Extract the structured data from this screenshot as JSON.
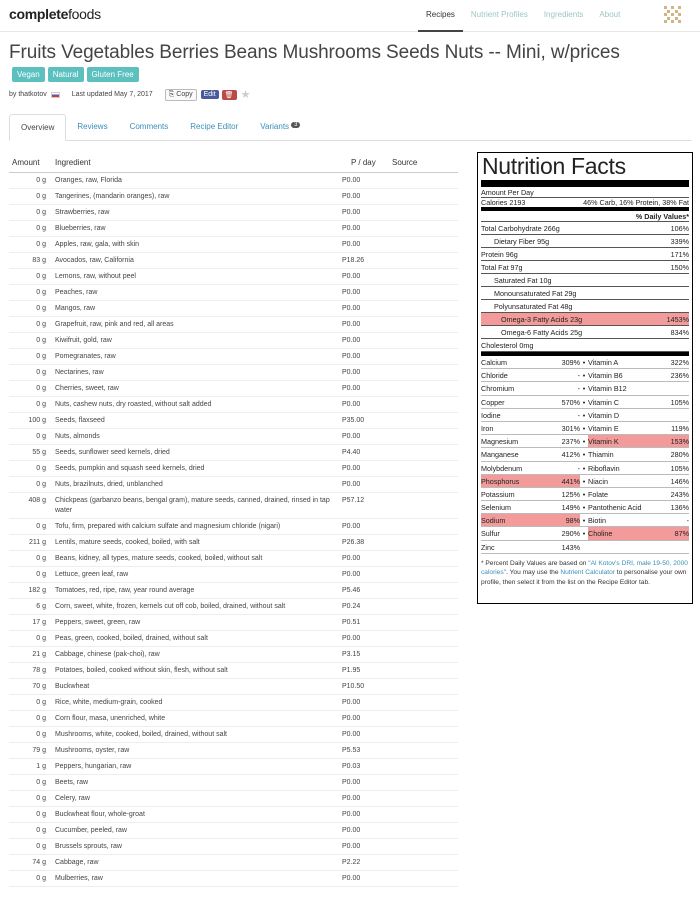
{
  "header": {
    "logo_bold": "complete",
    "logo_light": "foods",
    "nav": [
      "Recipes",
      "Nutrient Profiles",
      "Ingredients",
      "About"
    ]
  },
  "recipe": {
    "title": "Fruits Vegetables Berries Beans Mushrooms Seeds Nuts -- Mini, w/prices",
    "tags": [
      "Vegan",
      "Natural",
      "Gluten Free"
    ],
    "by": "by thatkotov",
    "updated": "Last updated May 7, 2017",
    "copy_label": "Copy",
    "edit_label": "Edit"
  },
  "tabs": [
    {
      "label": "Overview"
    },
    {
      "label": "Reviews"
    },
    {
      "label": "Comments"
    },
    {
      "label": "Recipe Editor"
    },
    {
      "label": "Variants",
      "badge": "3"
    }
  ],
  "table": {
    "headers": {
      "amount": "Amount",
      "ingredient": "Ingredient",
      "price": "P / day",
      "source": "Source"
    },
    "rows": [
      {
        "amount": "0 g",
        "name": "Oranges, raw, Florida",
        "price": "P0.00"
      },
      {
        "amount": "0 g",
        "name": "Tangerines, (mandarin oranges), raw",
        "price": "P0.00"
      },
      {
        "amount": "0 g",
        "name": "Strawberries, raw",
        "price": "P0.00"
      },
      {
        "amount": "0 g",
        "name": "Blueberries, raw",
        "price": "P0.00"
      },
      {
        "amount": "0 g",
        "name": "Apples, raw, gala, with skin",
        "price": "P0.00"
      },
      {
        "amount": "83 g",
        "name": "Avocados, raw, California",
        "price": "P18.26"
      },
      {
        "amount": "0 g",
        "name": "Lemons, raw, without peel",
        "price": "P0.00"
      },
      {
        "amount": "0 g",
        "name": "Peaches, raw",
        "price": "P0.00"
      },
      {
        "amount": "0 g",
        "name": "Mangos, raw",
        "price": "P0.00"
      },
      {
        "amount": "0 g",
        "name": "Grapefruit, raw, pink and red, all areas",
        "price": "P0.00"
      },
      {
        "amount": "0 g",
        "name": "Kiwifruit, gold, raw",
        "price": "P0.00"
      },
      {
        "amount": "0 g",
        "name": "Pomegranates, raw",
        "price": "P0.00"
      },
      {
        "amount": "0 g",
        "name": "Nectarines, raw",
        "price": "P0.00"
      },
      {
        "amount": "0 g",
        "name": "Cherries, sweet, raw",
        "price": "P0.00"
      },
      {
        "amount": "0 g",
        "name": "Nuts, cashew nuts, dry roasted, without salt added",
        "price": "P0.00"
      },
      {
        "amount": "100 g",
        "name": "Seeds, flaxseed",
        "price": "P35.00"
      },
      {
        "amount": "0 g",
        "name": "Nuts, almonds",
        "price": "P0.00"
      },
      {
        "amount": "55 g",
        "name": "Seeds, sunflower seed kernels, dried",
        "price": "P4.40"
      },
      {
        "amount": "0 g",
        "name": "Seeds, pumpkin and squash seed kernels, dried",
        "price": "P0.00"
      },
      {
        "amount": "0 g",
        "name": "Nuts, brazilnuts, dried, unblanched",
        "price": "P0.00"
      },
      {
        "amount": "408 g",
        "name": "Chickpeas (garbanzo beans, bengal gram), mature seeds, canned, drained, rinsed in tap water",
        "price": "P57.12"
      },
      {
        "amount": "0 g",
        "name": "Tofu, firm, prepared with calcium sulfate and magnesium chloride (nigari)",
        "price": "P0.00"
      },
      {
        "amount": "211 g",
        "name": "Lentils, mature seeds, cooked, boiled, with salt",
        "price": "P26.38"
      },
      {
        "amount": "0 g",
        "name": "Beans, kidney, all types, mature seeds, cooked, boiled, without salt",
        "price": "P0.00"
      },
      {
        "amount": "0 g",
        "name": "Lettuce, green leaf, raw",
        "price": "P0.00"
      },
      {
        "amount": "182 g",
        "name": "Tomatoes, red, ripe, raw, year round average",
        "price": "P5.46"
      },
      {
        "amount": "6 g",
        "name": "Corn, sweet, white, frozen, kernels cut off cob, boiled, drained, without salt",
        "price": "P0.24"
      },
      {
        "amount": "17 g",
        "name": "Peppers, sweet, green, raw",
        "price": "P0.51"
      },
      {
        "amount": "0 g",
        "name": "Peas, green, cooked, boiled, drained, without salt",
        "price": "P0.00"
      },
      {
        "amount": "21 g",
        "name": "Cabbage, chinese (pak-choi), raw",
        "price": "P3.15"
      },
      {
        "amount": "78 g",
        "name": "Potatoes, boiled, cooked without skin, flesh, without salt",
        "price": "P1.95"
      },
      {
        "amount": "70 g",
        "name": "Buckwheat",
        "price": "P10.50"
      },
      {
        "amount": "0 g",
        "name": "Rice, white, medium-grain, cooked",
        "price": "P0.00"
      },
      {
        "amount": "0 g",
        "name": "Corn flour, masa, unenriched, white",
        "price": "P0.00"
      },
      {
        "amount": "0 g",
        "name": "Mushrooms, white, cooked, boiled, drained, without salt",
        "price": "P0.00"
      },
      {
        "amount": "79 g",
        "name": "Mushrooms, oyster, raw",
        "price": "P5.53"
      },
      {
        "amount": "1 g",
        "name": "Peppers, hungarian, raw",
        "price": "P0.03"
      },
      {
        "amount": "0 g",
        "name": "Beets, raw",
        "price": "P0.00"
      },
      {
        "amount": "0 g",
        "name": "Celery, raw",
        "price": "P0.00"
      },
      {
        "amount": "0 g",
        "name": "Buckwheat flour, whole-groat",
        "price": "P0.00"
      },
      {
        "amount": "0 g",
        "name": "Cucumber, peeled, raw",
        "price": "P0.00"
      },
      {
        "amount": "0 g",
        "name": "Brussels sprouts, raw",
        "price": "P0.00"
      },
      {
        "amount": "74 g",
        "name": "Cabbage, raw",
        "price": "P2.22"
      },
      {
        "amount": "0 g",
        "name": "Mulberries, raw",
        "price": "P0.00"
      }
    ]
  },
  "nutrition": {
    "title": "Nutrition Facts",
    "amount_per_day": "Amount Per Day",
    "calories_label": "Calories 2193",
    "calories_split": "46% Carb, 16% Protein, 38% Fat",
    "dv_header": "% Daily Values*",
    "macros": [
      {
        "label": "Total Carbohydrate 266g",
        "value": "106%",
        "indent": false,
        "highlight": false
      },
      {
        "label": "Dietary Fiber 95g",
        "value": "339%",
        "indent": true,
        "highlight": false
      },
      {
        "label": "Protein 96g",
        "value": "171%",
        "indent": false,
        "highlight": false
      },
      {
        "label": "Total Fat 97g",
        "value": "150%",
        "indent": false,
        "highlight": false
      },
      {
        "label": "Saturated Fat 10g",
        "value": "",
        "indent": true,
        "highlight": false
      },
      {
        "label": "Monounsaturated Fat 29g",
        "value": "",
        "indent": true,
        "highlight": false
      },
      {
        "label": "Polyunsaturated Fat 48g",
        "value": "",
        "indent": true,
        "highlight": false
      },
      {
        "label": "Omega-3 Fatty Acids 23g",
        "value": "1453%",
        "indent": true,
        "highlight": true
      },
      {
        "label": "Omega-6 Fatty Acids 25g",
        "value": "834%",
        "indent": true,
        "highlight": false
      },
      {
        "label": "Cholesterol 0mg",
        "value": "",
        "indent": false,
        "highlight": false
      }
    ],
    "micros": [
      {
        "l": "Calcium",
        "lv": "309%",
        "r": "Vitamin A",
        "rv": "322%",
        "lh": false,
        "rh": false
      },
      {
        "l": "Chloride",
        "lv": "-",
        "r": "Vitamin B6",
        "rv": "236%",
        "lh": false,
        "rh": false
      },
      {
        "l": "Chromium",
        "lv": "-",
        "r": "Vitamin B12",
        "rv": "",
        "lh": false,
        "rh": false
      },
      {
        "l": "Copper",
        "lv": "570%",
        "r": "Vitamin C",
        "rv": "105%",
        "lh": false,
        "rh": false
      },
      {
        "l": "Iodine",
        "lv": "-",
        "r": "Vitamin D",
        "rv": "",
        "lh": false,
        "rh": false
      },
      {
        "l": "Iron",
        "lv": "301%",
        "r": "Vitamin E",
        "rv": "119%",
        "lh": false,
        "rh": false
      },
      {
        "l": "Magnesium",
        "lv": "237%",
        "r": "Vitamin K",
        "rv": "153%",
        "lh": false,
        "rh": true
      },
      {
        "l": "Manganese",
        "lv": "412%",
        "r": "Thiamin",
        "rv": "280%",
        "lh": false,
        "rh": false
      },
      {
        "l": "Molybdenum",
        "lv": "-",
        "r": "Riboflavin",
        "rv": "105%",
        "lh": false,
        "rh": false
      },
      {
        "l": "Phosphorus",
        "lv": "441%",
        "r": "Niacin",
        "rv": "146%",
        "lh": true,
        "rh": false
      },
      {
        "l": "Potassium",
        "lv": "125%",
        "r": "Folate",
        "rv": "243%",
        "lh": false,
        "rh": false
      },
      {
        "l": "Selenium",
        "lv": "149%",
        "r": "Pantothenic Acid",
        "rv": "136%",
        "lh": false,
        "rh": false
      },
      {
        "l": "Sodium",
        "lv": "98%",
        "r": "Biotin",
        "rv": "-",
        "lh": true,
        "rh": false
      },
      {
        "l": "Sulfur",
        "lv": "290%",
        "r": "Choline",
        "rv": "87%",
        "lh": false,
        "rh": true
      },
      {
        "l": "Zinc",
        "lv": "143%",
        "r": "",
        "rv": "",
        "lh": false,
        "rh": false
      }
    ],
    "footnote_1": "* Percent Daily Values are based on ",
    "footnote_link1": "\"Al Kotov's DRI, male 19-50, 2000 calories\"",
    "footnote_2": ". You may use the ",
    "footnote_link2": "Nutrient Calculator",
    "footnote_3": " to personalise your own profile, then select it from the list on the Recipe Editor tab."
  }
}
